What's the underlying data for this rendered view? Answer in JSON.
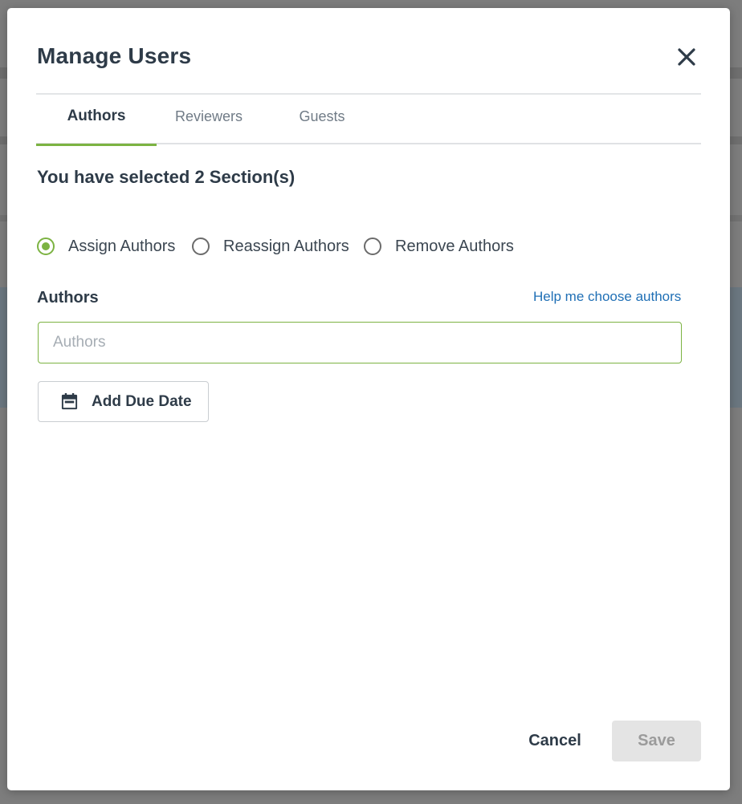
{
  "modal": {
    "title": "Manage Users"
  },
  "tabs": [
    {
      "label": "Authors",
      "active": true
    },
    {
      "label": "Reviewers",
      "active": false
    },
    {
      "label": "Guests",
      "active": false
    }
  ],
  "selection": {
    "text": "You have selected 2 Section(s)"
  },
  "radio_options": [
    {
      "label": "Assign Authors",
      "checked": true
    },
    {
      "label": "Reassign Authors",
      "checked": false
    },
    {
      "label": "Remove Authors",
      "checked": false
    }
  ],
  "authors_field": {
    "label": "Authors",
    "placeholder": "Authors",
    "value": "",
    "help_link": "Help me choose authors"
  },
  "due_date": {
    "label": "Add Due Date",
    "icon": "calendar-icon"
  },
  "footer": {
    "cancel_label": "Cancel",
    "save_label": "Save"
  },
  "colors": {
    "accent": "#7cb342",
    "link": "#1f6fb5",
    "text": "#2e3b48",
    "disabled_bg": "#e4e4e4"
  }
}
